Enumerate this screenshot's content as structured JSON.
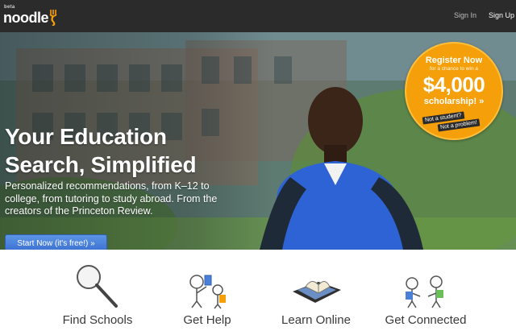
{
  "header": {
    "logo_beta": "beta",
    "logo_text": "noodle",
    "sign_in": "Sign In",
    "sign_up": "Sign Up"
  },
  "hero": {
    "headline_line1": "Your Education",
    "headline_line2": "Search, Simplified",
    "subcopy": "Personalized recommendations, from K–12 to college, from tutoring to study abroad. From the creators of the Princeton Review.",
    "cta_label": "Start Now (it's free!) »"
  },
  "promo": {
    "line1": "Register Now",
    "line2": "for a chance to win a",
    "amount": "$4,000",
    "line4": "scholarship! »",
    "tag1": "Not a student?",
    "tag2": "Not a problem!"
  },
  "features": [
    {
      "label": "Find Schools",
      "icon": "magnifier-icon"
    },
    {
      "label": "Get Help",
      "icon": "tutoring-icon"
    },
    {
      "label": "Learn Online",
      "icon": "tablet-book-icon"
    },
    {
      "label": "Get Connected",
      "icon": "people-talking-icon"
    }
  ],
  "colors": {
    "topbar": "#2b2b2b",
    "cta_blue": "#3a6fd0",
    "promo_orange": "#f5a00b"
  }
}
